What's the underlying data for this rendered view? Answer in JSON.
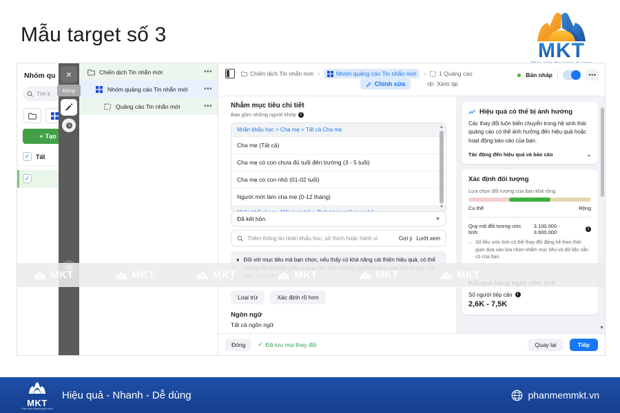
{
  "header": {
    "title": "Mẫu target số 3",
    "brand": {
      "name": "MKT",
      "tagline": "Phần mềm Marketing đa kênh"
    }
  },
  "left_panel": {
    "title": "Nhóm qu",
    "search_placeholder": "Tìm k",
    "create_label": "Tạo",
    "rows": [
      {
        "label": "Tất"
      },
      {
        "label": ""
      }
    ]
  },
  "dark_toolbar": {
    "close_label": "×",
    "tooltip": "Đóng",
    "icons": [
      "close-icon",
      "pencil-icon",
      "clock-icon",
      "back-icon"
    ]
  },
  "tree": {
    "items": [
      {
        "label": "Chiến dịch Tin nhắn mới",
        "icon": "folder-icon",
        "menu": "•••"
      },
      {
        "label": "Nhóm quảng cáo Tin nhắn mới",
        "icon": "grid-icon",
        "menu": "•••"
      },
      {
        "label": "Quảng cáo Tin nhắn mới",
        "icon": "ad-icon",
        "menu": "•••"
      }
    ]
  },
  "editor": {
    "breadcrumb": [
      {
        "label": "Chiến dịch Tin nhắn mới",
        "icon": "folder-icon"
      },
      {
        "label": "Nhóm quảng cáo Tin nhắn mới",
        "icon": "grid-icon"
      },
      {
        "label": "1 Quảng cáo",
        "icon": "ad-icon"
      }
    ],
    "separator": ">",
    "status": {
      "label": "Bản nháp",
      "color": "#42b72a"
    },
    "more_label": "•••",
    "tabs": [
      {
        "label": "Chỉnh sửa",
        "icon": "pencil-icon",
        "active": true
      },
      {
        "label": "Xem lại",
        "icon": "eye-icon",
        "active": false
      }
    ]
  },
  "main": {
    "section_title": "Nhắm mục tiêu chi tiết",
    "section_subtitle": "Bao gồm những người khớp",
    "targeting_groups": [
      {
        "category": "Nhân khẩu học > Cha mẹ > Tất cả Cha mẹ",
        "items": [
          "Cha mẹ (Tất cả)",
          "Cha mẹ có con chưa đủ tuổi đến trường (3 - 5 tuổi)",
          "Cha mẹ có con nhỏ (01-02 tuổi)",
          "Người mới làm cha mẹ (0-12 tháng)"
        ]
      },
      {
        "category": "Nhân khẩu học > Mối quan hệ > Tình trạng mối quan hệ",
        "items": []
      }
    ],
    "relationship_value": "Đã kết hôn",
    "search_placeholder": "Thêm thông tin nhân khẩu học, sở thích hoặc hành vi",
    "search_actions": [
      "Gợi ý",
      "Lướt xem"
    ],
    "tip": "Đối với mục tiêu mà bạn chọn, nếu thấy có khả năng cải thiện hiệu quả, có thể chúng tôi sẽ phân phối quảng cáo cho những người không phải đối tượng của bạn.",
    "tip_link": "Learn more.",
    "buttons": [
      "Loại trừ",
      "Xác định rõ hơn"
    ],
    "language_title": "Ngôn ngữ",
    "language_value": "Tất cả ngôn ngữ"
  },
  "sidebar": {
    "performance_card": {
      "title": "Hiệu quả có thể bị ảnh hưởng",
      "body": "Các thay đổi luôn biến chuyển trong hệ sinh thái quảng cáo có thể ảnh hưởng đến hiệu quả hoặc hoạt động báo cáo của bạn.",
      "expand_label": "Tác động đến hiệu quả và báo cáo"
    },
    "audience_card": {
      "title": "Xác định đối tượng",
      "note": "Lựa chọn đối tượng của bạn khá rộng.",
      "meter_left": "Cụ thể",
      "meter_right": "Rộng",
      "size_label": "Quy mô đối tượng ước tính:",
      "size_value": "3.100.000 - 3.600.000",
      "disclaimer": "Số liệu ước tính có thể thay đổi đáng kể theo thời gian dựa vào lựa chọn nhắm mục tiêu và dữ liệu sẵn có của bạn."
    },
    "results_card": {
      "title": "Kết quả hàng ngày ước tính",
      "reach_label": "Số người tiếp cận",
      "reach_value": "2,6K - 7,5K"
    }
  },
  "editor_footer": {
    "close": "Đóng",
    "saved": "Đã lưu mọi thay đổi",
    "back": "Quay lại",
    "next": "Tiếp"
  },
  "watermark": {
    "text": "MKT",
    "count": 6
  },
  "footer": {
    "logo_name": "MKT",
    "logo_tag": "Phần mềm Marketing đa kênh",
    "slogan": "Hiệu quả - Nhanh - Dễ dùng",
    "url": "phanmemmkt.vn"
  }
}
